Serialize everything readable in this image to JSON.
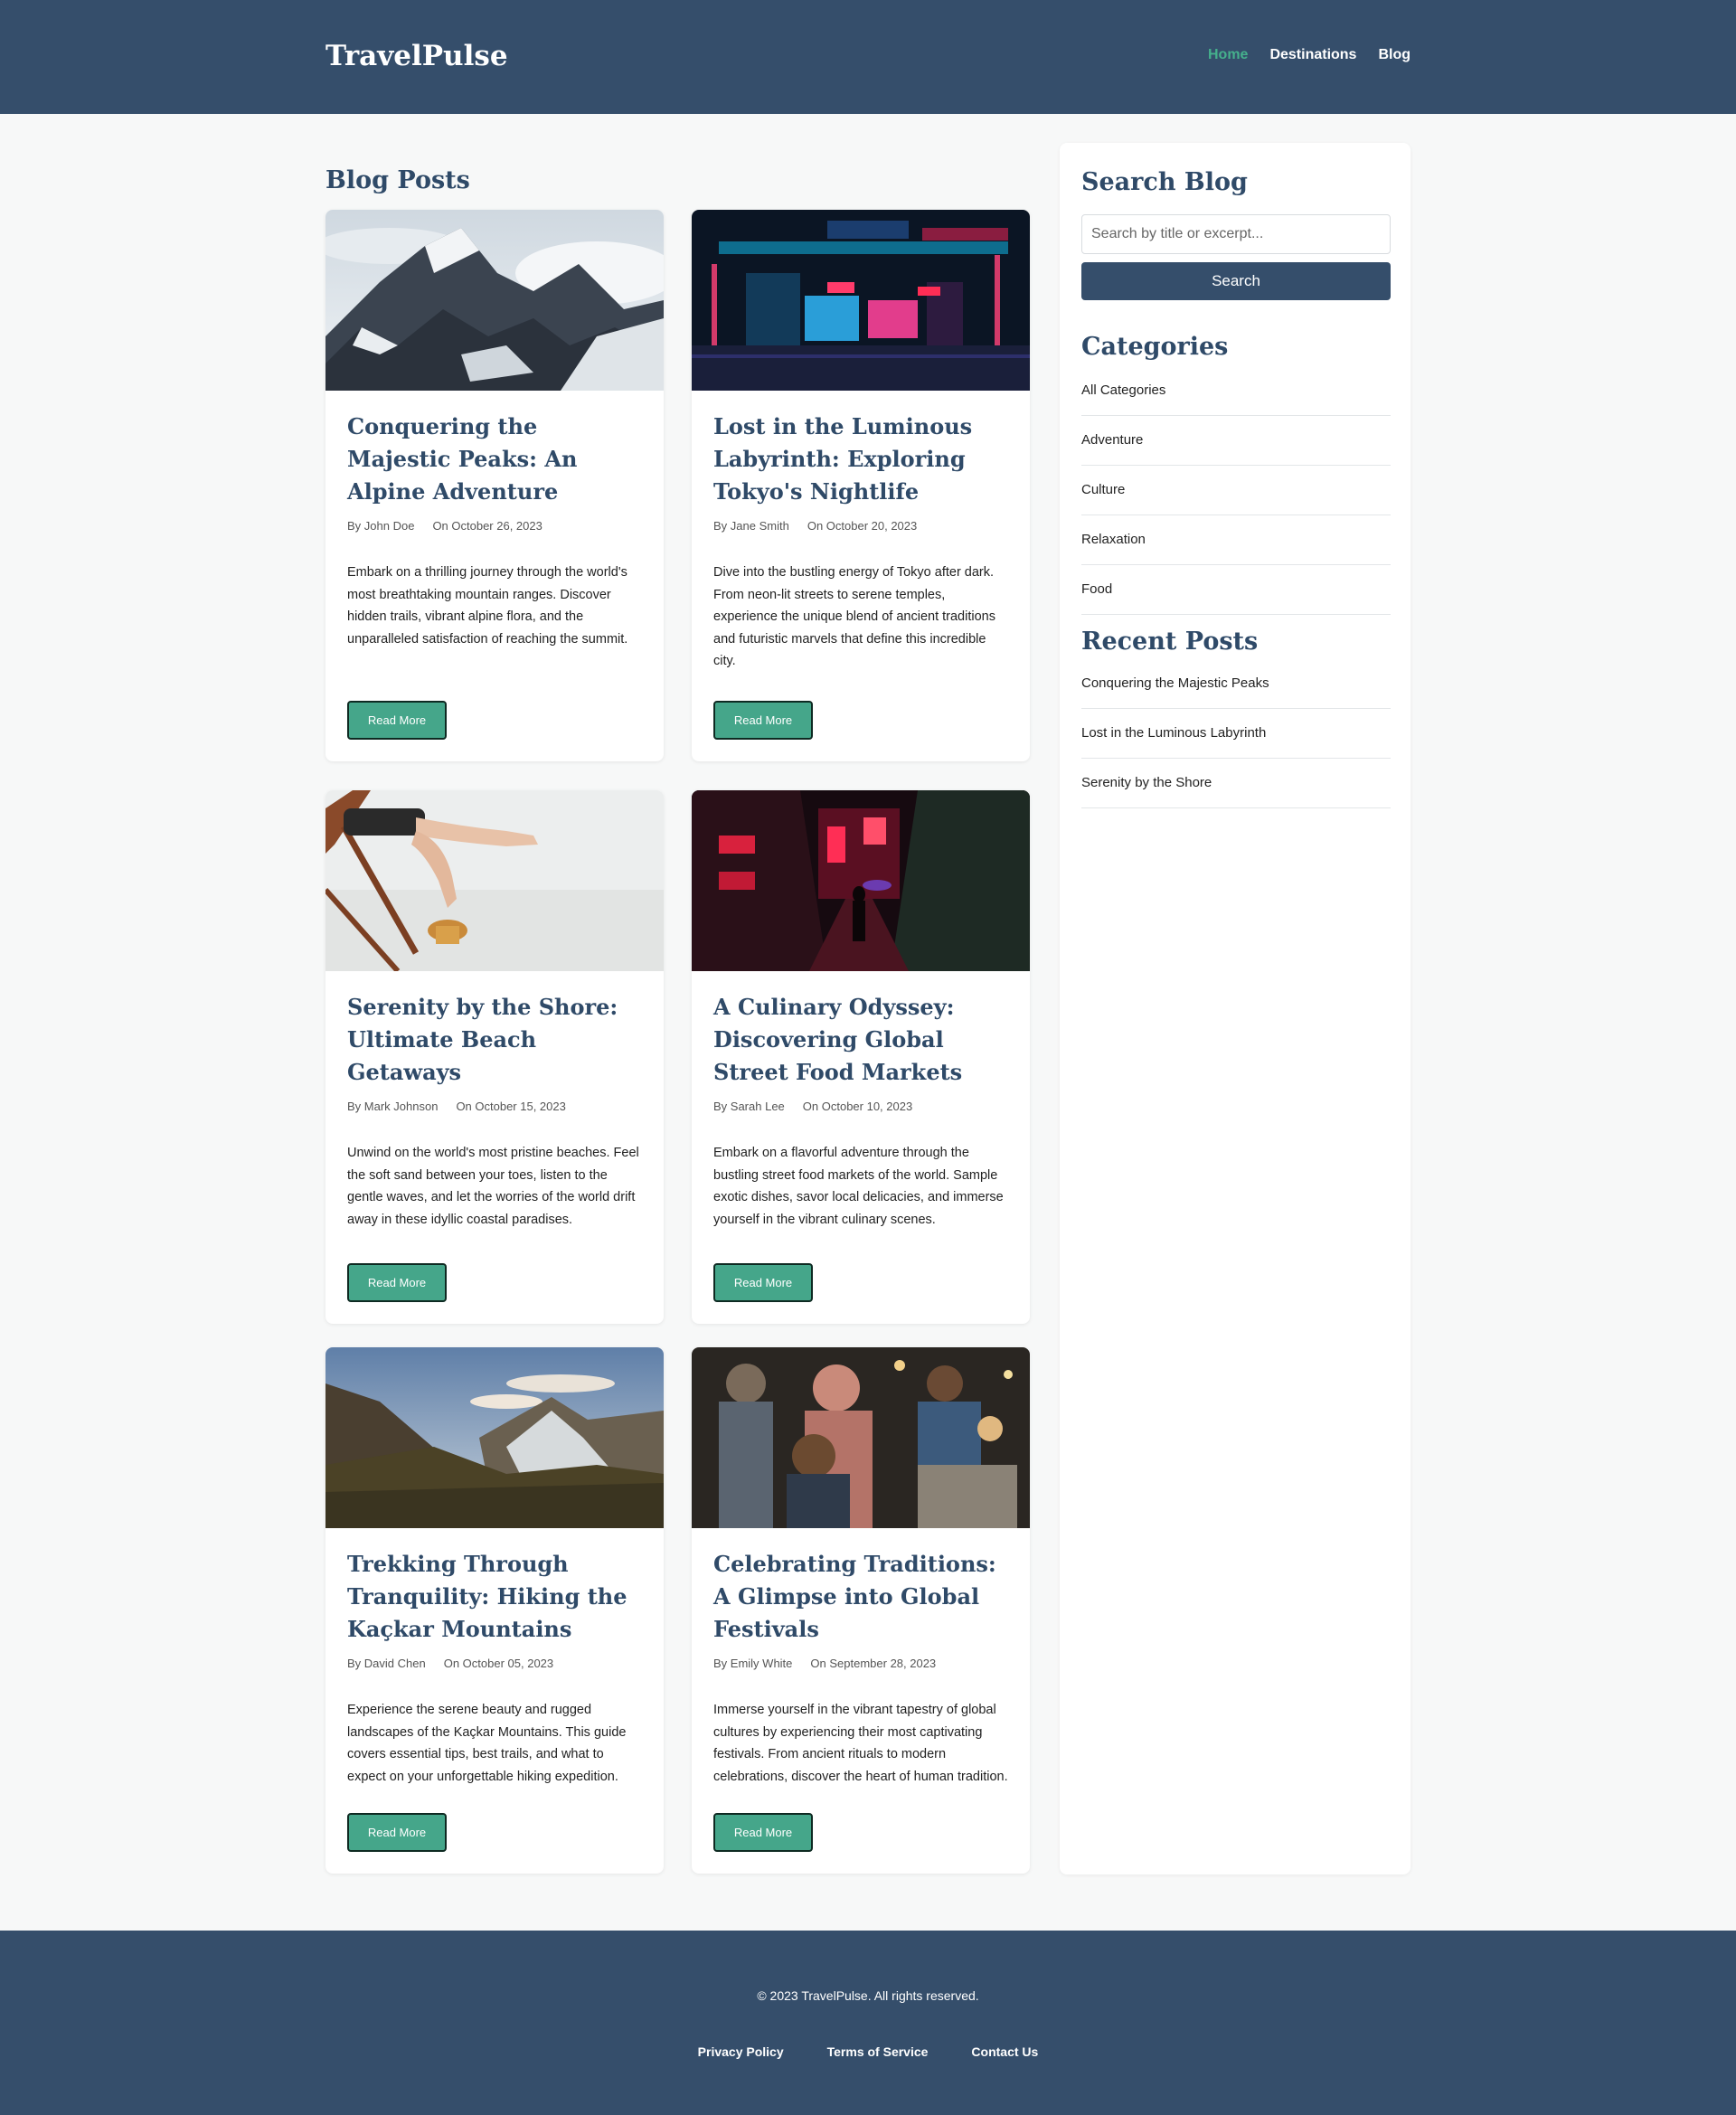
{
  "header": {
    "brand": "TravelPulse",
    "nav": [
      {
        "label": "Home",
        "active": true
      },
      {
        "label": "Destinations",
        "active": false
      },
      {
        "label": "Blog",
        "active": false
      }
    ]
  },
  "main": {
    "section_title": "Blog Posts",
    "read_more_label": "Read More",
    "posts": [
      {
        "title": "Conquering the Majestic Peaks: An Alpine Adventure",
        "author": "By John Doe",
        "date": "On October 26, 2023",
        "excerpt": "Embark on a thrilling journey through the world's most breathtaking mountain ranges. Discover hidden trails, vibrant alpine flora, and the unparalleled satisfaction of reaching the summit."
      },
      {
        "title": "Lost in the Luminous Labyrinth: Exploring Tokyo's Nightlife",
        "author": "By Jane Smith",
        "date": "On October 20, 2023",
        "excerpt": "Dive into the bustling energy of Tokyo after dark. From neon-lit streets to serene temples, experience the unique blend of ancient traditions and futuristic marvels that define this incredible city."
      },
      {
        "title": "Serenity by the Shore: Ultimate Beach Getaways",
        "author": "By Mark Johnson",
        "date": "On October 15, 2023",
        "excerpt": "Unwind on the world's most pristine beaches. Feel the soft sand between your toes, listen to the gentle waves, and let the worries of the world drift away in these idyllic coastal paradises."
      },
      {
        "title": "A Culinary Odyssey: Discovering Global Street Food Markets",
        "author": "By Sarah Lee",
        "date": "On October 10, 2023",
        "excerpt": "Embark on a flavorful adventure through the bustling street food markets of the world. Sample exotic dishes, savor local delicacies, and immerse yourself in the vibrant culinary scenes."
      },
      {
        "title": "Trekking Through Tranquility: Hiking the Kaçkar Mountains",
        "author": "By David Chen",
        "date": "On October 05, 2023",
        "excerpt": "Experience the serene beauty and rugged landscapes of the Kaçkar Mountains. This guide covers essential tips, best trails, and what to expect on your unforgettable hiking expedition."
      },
      {
        "title": "Celebrating Traditions: A Glimpse into Global Festivals",
        "author": "By Emily White",
        "date": "On September 28, 2023",
        "excerpt": "Immerse yourself in the vibrant tapestry of global cultures by experiencing their most captivating festivals. From ancient rituals to modern celebrations, discover the heart of human tradition."
      }
    ]
  },
  "sidebar": {
    "search_title": "Search Blog",
    "search_placeholder": "Search by title or excerpt...",
    "search_button": "Search",
    "categories_title": "Categories",
    "categories": [
      "All Categories",
      "Adventure",
      "Culture",
      "Relaxation",
      "Food"
    ],
    "recent_title": "Recent Posts",
    "recent": [
      "Conquering the Majestic Peaks",
      "Lost in the Luminous Labyrinth",
      "Serenity by the Shore"
    ]
  },
  "footer": {
    "copyright": "© 2023 TravelPulse. All rights reserved.",
    "links": [
      "Privacy Policy",
      "Terms of Service",
      "Contact Us"
    ]
  },
  "colors": {
    "primary": "#354e6b",
    "accent": "#45b08c",
    "button": "#45a68a"
  }
}
